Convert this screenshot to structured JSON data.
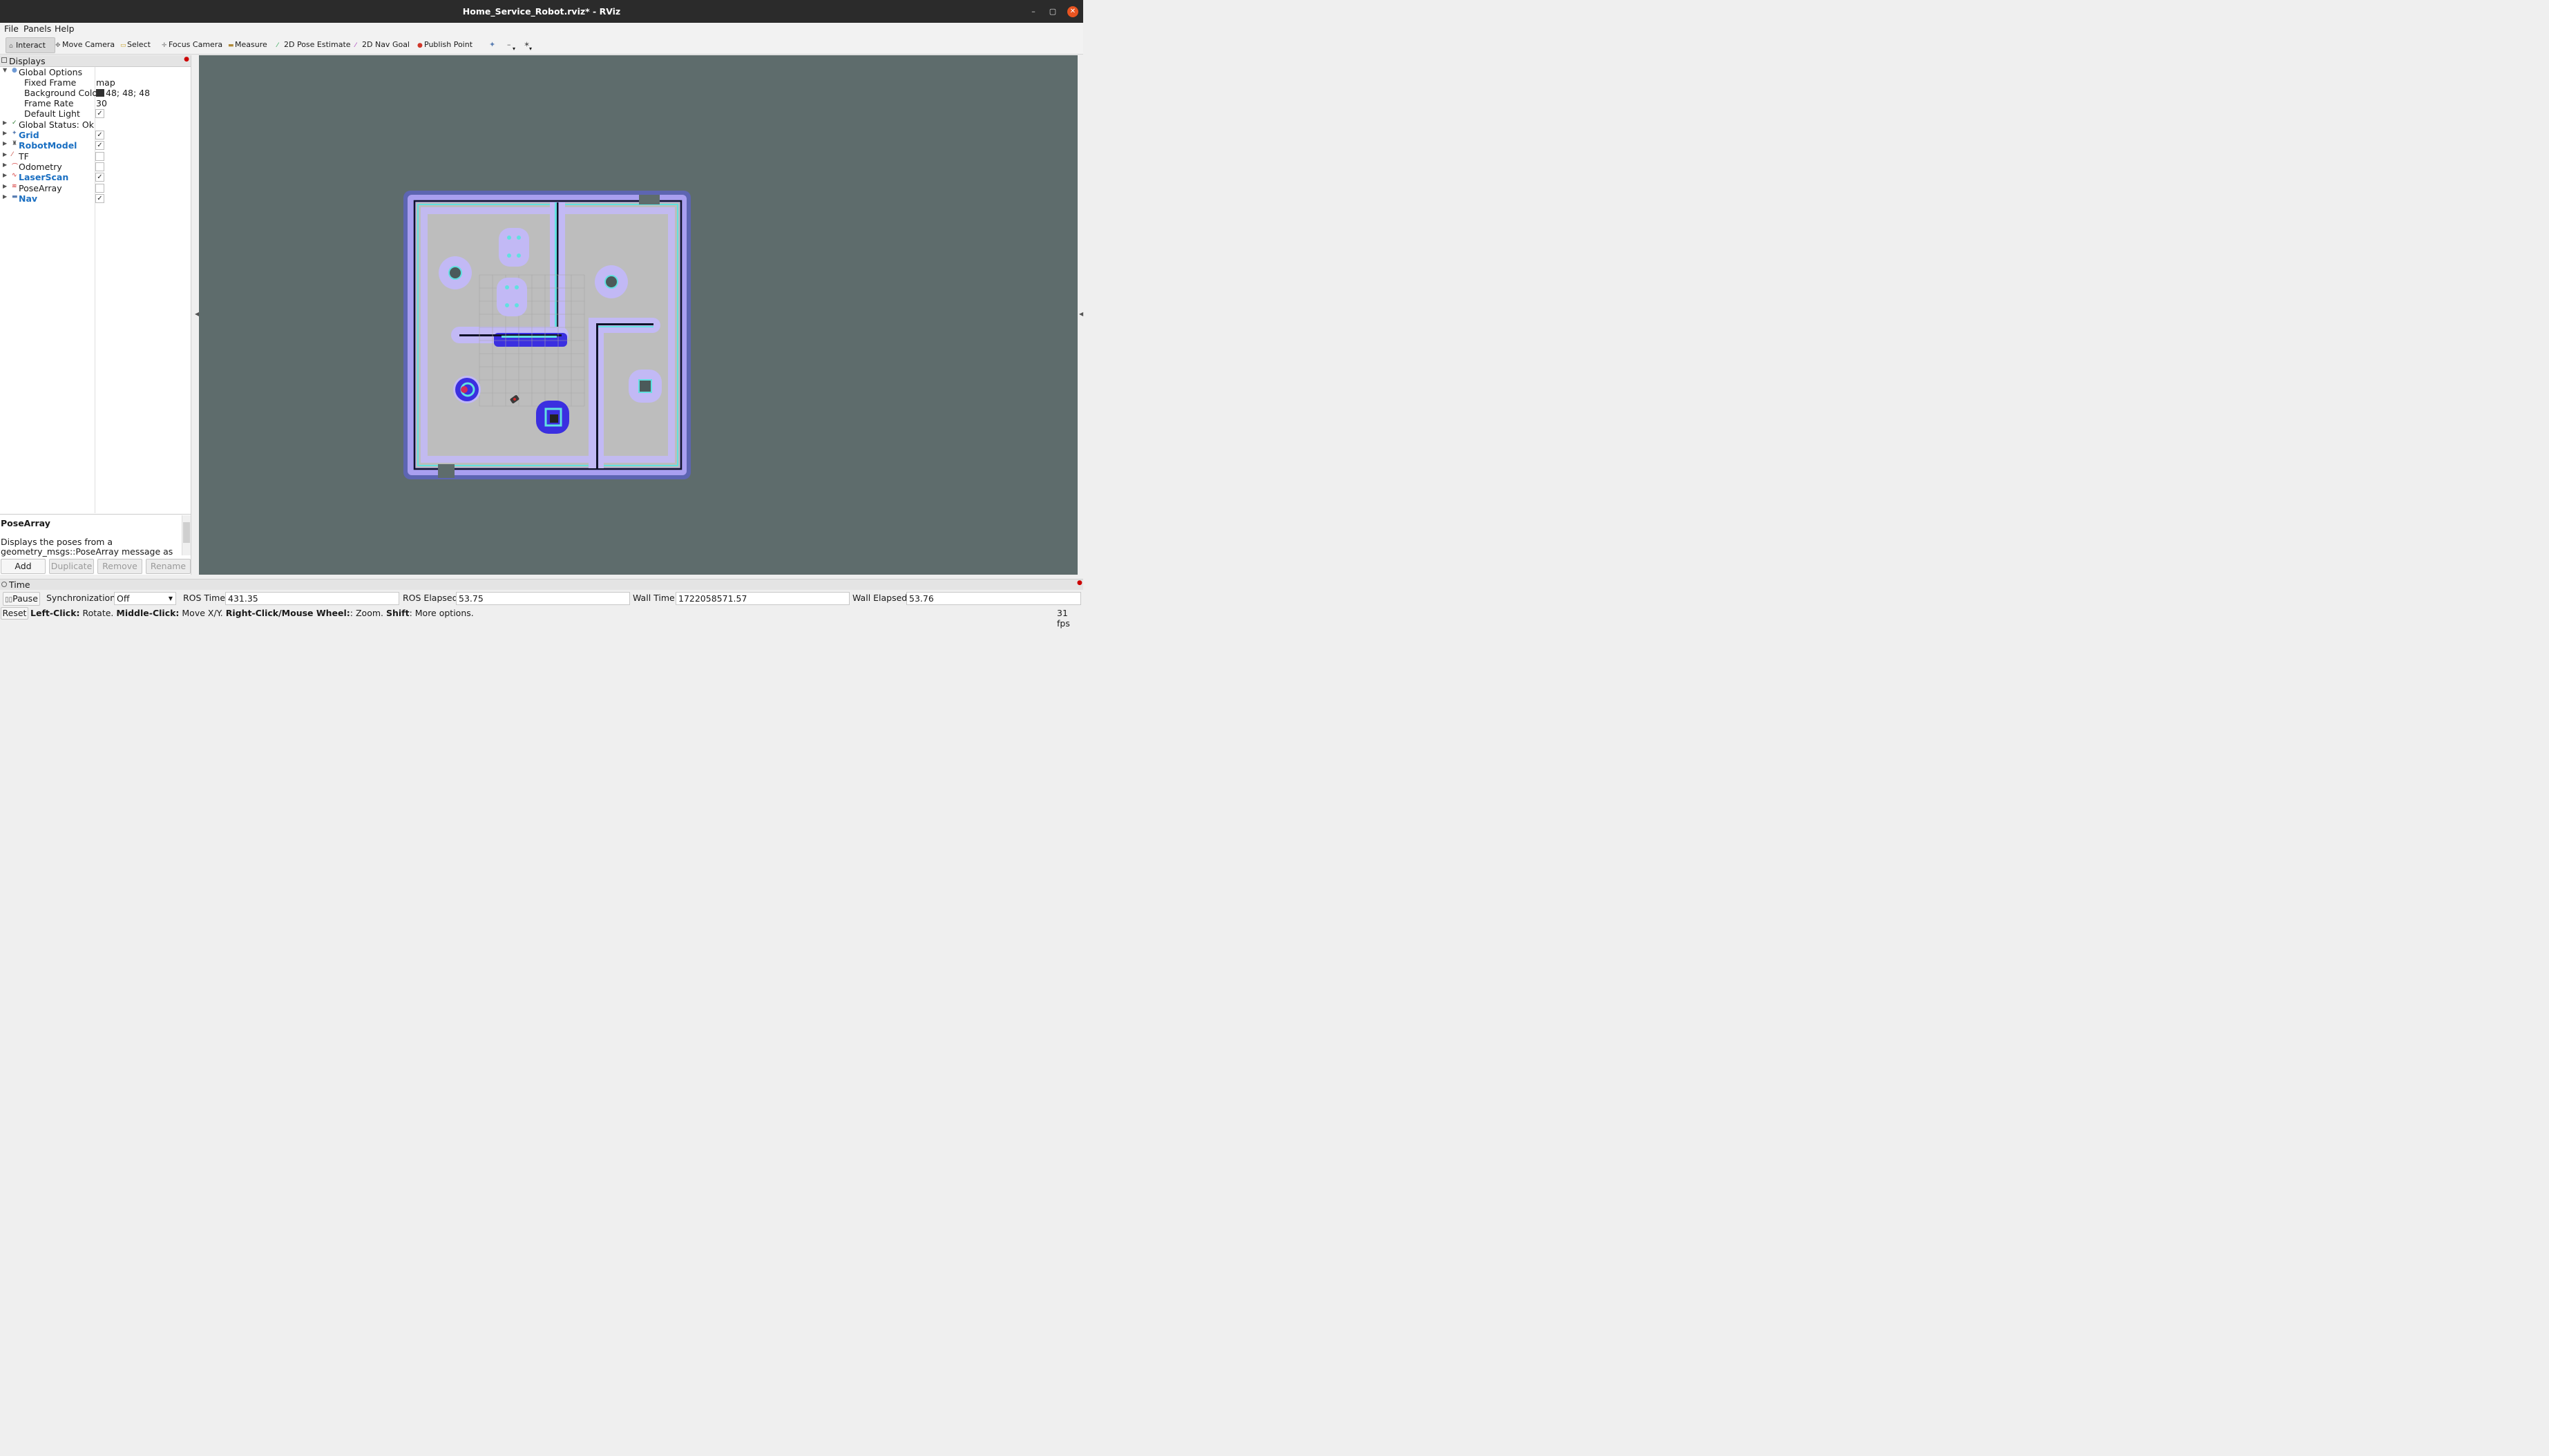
{
  "window": {
    "title": "Home_Service_Robot.rviz* - RViz",
    "minimize": "–",
    "maximize": "▢",
    "close": "✕"
  },
  "menu": [
    "File",
    "Panels",
    "Help"
  ],
  "toolbar": {
    "interact": "Interact",
    "move_camera": "Move Camera",
    "select": "Select",
    "focus_camera": "Focus Camera",
    "measure": "Measure",
    "pose_estimate": "2D Pose Estimate",
    "nav_goal": "2D Nav Goal",
    "publish_point": "Publish Point"
  },
  "displays": {
    "title": "Displays",
    "global_options": "Global Options",
    "fixed_frame_label": "Fixed Frame",
    "fixed_frame": "map",
    "bg_color_label": "Background Color",
    "bg_color": "48; 48; 48",
    "frame_rate_label": "Frame Rate",
    "frame_rate": "30",
    "default_light_label": "Default Light",
    "default_light": true,
    "global_status": "Global Status: Ok",
    "items": [
      {
        "name": "Grid",
        "checked": true,
        "bold": true,
        "icon": "grid-icon",
        "color": "#5b7fb3"
      },
      {
        "name": "RobotModel",
        "checked": true,
        "bold": true,
        "icon": "robot-icon",
        "color": "#555555"
      },
      {
        "name": "TF",
        "checked": false,
        "bold": false,
        "icon": "tf-icon",
        "color": "#c0392b"
      },
      {
        "name": "Odometry",
        "checked": false,
        "bold": false,
        "icon": "odometry-icon",
        "color": "#d32f2f"
      },
      {
        "name": "LaserScan",
        "checked": true,
        "bold": true,
        "icon": "laserscan-icon",
        "color": "#d32f2f"
      },
      {
        "name": "PoseArray",
        "checked": false,
        "bold": false,
        "icon": "posearray-icon",
        "color": "#d32f2f"
      },
      {
        "name": "Nav",
        "checked": true,
        "bold": true,
        "icon": "folder-icon",
        "color": "#5b7fb3"
      }
    ]
  },
  "description": {
    "title": "PoseArray",
    "body": "Displays the poses from a geometry_msgs::PoseArray message as a"
  },
  "panel_buttons": {
    "add": "Add",
    "duplicate": "Duplicate",
    "remove": "Remove",
    "rename": "Rename"
  },
  "time": {
    "title": "Time",
    "pause": "Pause",
    "sync_label": "Synchronization:",
    "sync_value": "Off",
    "ros_time_label": "ROS Time:",
    "ros_time": "431.35",
    "ros_elapsed_label": "ROS Elapsed:",
    "ros_elapsed": "53.75",
    "wall_time_label": "Wall Time:",
    "wall_time": "1722058571.57",
    "wall_elapsed_label": "Wall Elapsed:",
    "wall_elapsed": "53.76"
  },
  "status": {
    "reset": "Reset",
    "left_click": "Left-Click:",
    "left_click_desc": " Rotate. ",
    "middle_click": "Middle-Click:",
    "middle_click_desc": " Move X/Y. ",
    "right_click": "Right-Click/Mouse Wheel:",
    "right_click_desc": ": Zoom. ",
    "shift": "Shift",
    "shift_desc": ": More options.",
    "fps": "31 fps"
  },
  "colors": {
    "viewport_bg": "#5e6c6c",
    "map_free": "#bcbcbc",
    "costmap_halo": "#a89ff0",
    "inflation": "#3b2fe0",
    "cyan": "#55e5e5"
  }
}
